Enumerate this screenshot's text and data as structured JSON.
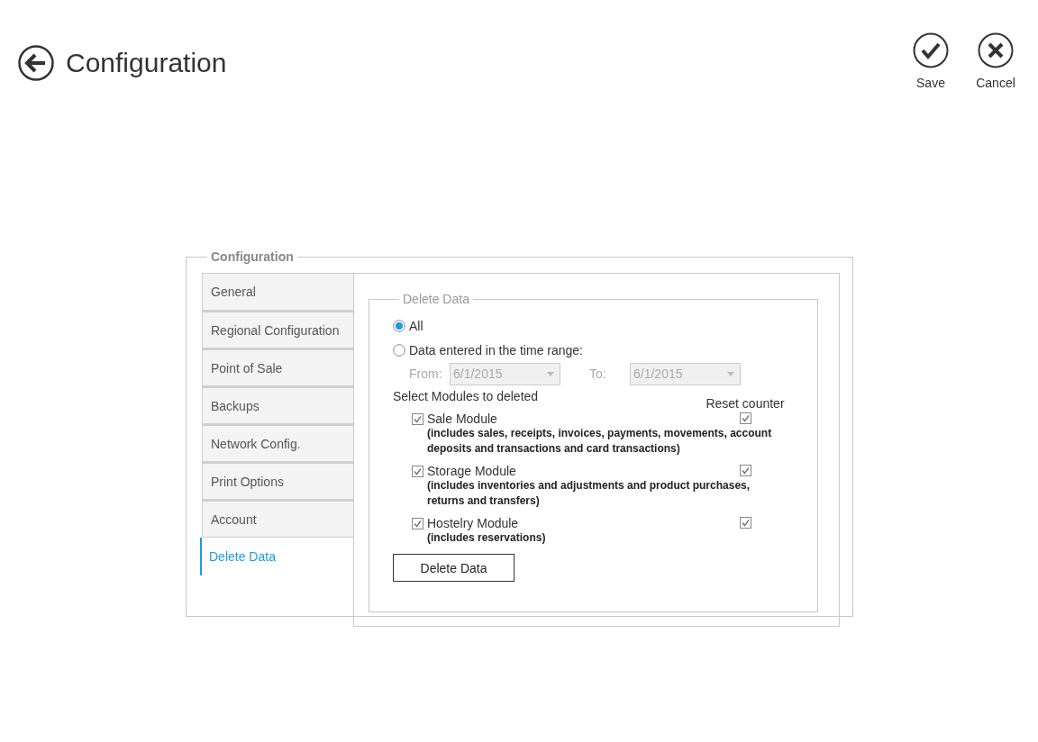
{
  "header": {
    "title": "Configuration",
    "actions": [
      {
        "kind": "save",
        "label": "Save"
      },
      {
        "kind": "cancel",
        "label": "Cancel"
      }
    ]
  },
  "group": {
    "title": "Configuration"
  },
  "tabs": [
    {
      "label": "General",
      "selected": false
    },
    {
      "label": "Regional Configuration",
      "selected": false
    },
    {
      "label": "Point of Sale",
      "selected": false
    },
    {
      "label": "Backups",
      "selected": false
    },
    {
      "label": "Network Config.",
      "selected": false
    },
    {
      "label": "Print Options",
      "selected": false
    },
    {
      "label": "Account",
      "selected": false
    },
    {
      "label": "Delete Data",
      "selected": true
    }
  ],
  "delete_panel": {
    "title": "Delete Data",
    "options": [
      {
        "label": "All",
        "selected": true
      },
      {
        "label": "Data entered in the time range:",
        "selected": false
      }
    ],
    "range": {
      "disabled": true,
      "from_label": "From:",
      "from_value": "6/1/2015",
      "to_label": "To:",
      "to_value": "6/1/2015"
    },
    "modules_heading": "Select Modules to deleted",
    "reset_heading": "Reset counter",
    "modules": [
      {
        "name": "Sale Module",
        "description": "(includes sales, receipts, invoices, payments, movements, account deposits and transactions and card transactions)",
        "checked": true,
        "reset_counter": true
      },
      {
        "name": "Storage Module",
        "description": "(includes inventories and adjustments and product purchases, returns and transfers)",
        "checked": true,
        "reset_counter": true
      },
      {
        "name": "Hostelry Module",
        "description": "(includes reservations)",
        "checked": true,
        "reset_counter": true
      }
    ],
    "button": "Delete Data"
  }
}
